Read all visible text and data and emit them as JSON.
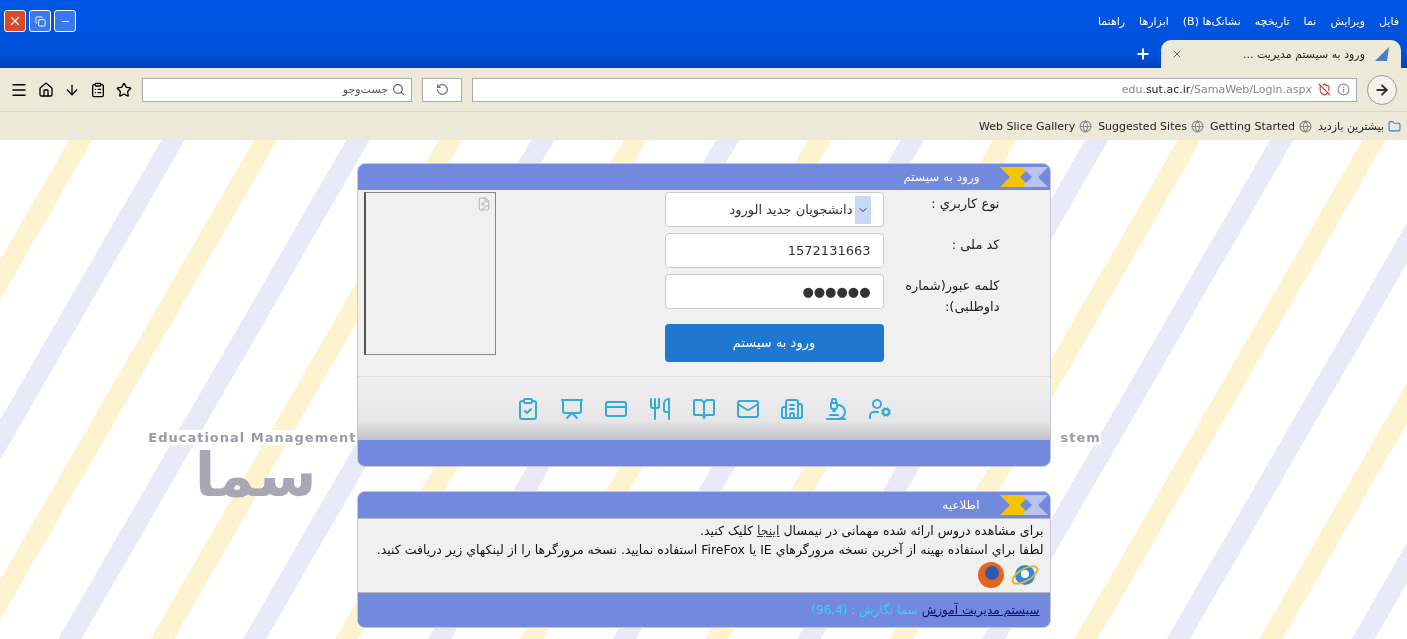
{
  "window": {
    "tab": {
      "title": "ورود به سیستم مدیریت ...",
      "selected": true
    }
  },
  "menu": [
    "فایل",
    "ویرایش",
    "نما",
    "تاریخچه",
    "نشانک‌ها (B)",
    "ابزارها",
    "راهنما"
  ],
  "toolbar": {
    "url": "edu.**sut.ac.ir**/SamaWeb/Login.aspx",
    "search": {
      "placeholder": "جست‌وجو"
    }
  },
  "bookmarks": [
    "بیشترین بازدید",
    "Getting Started",
    "Suggested Sites",
    "Web Slice Gallery"
  ],
  "background": {
    "caption_left": "Educational Management",
    "caption_right": "stem",
    "logo": "سما"
  },
  "login": {
    "title": "ورود به سیستم",
    "fields": [
      {
        "kind": "select",
        "label": "نوع کاربري :",
        "value": "دانشجویان جدید الورود"
      },
      {
        "kind": "text",
        "label": "کد ملی :",
        "value": "1572131663"
      },
      {
        "kind": "password",
        "label": "کلمه عبور(شماره داوطلبی):",
        "value": "●●●●●●"
      }
    ],
    "submit": "ورود به سیستم"
  },
  "notice": {
    "title": "اطلاعیه",
    "line1": {
      "before": "برای مشاهده دروس ارائه شده مهمانی در نیمسال ",
      "link": "اینجا",
      "after": " کلیک کنید."
    },
    "line2": "لطفا براي استفاده بهينه از آخرين نسخه مرورگرهاي IE يا FireFox استفاده نماييد. نسخه مرورگرها را از لينکهاي زير دريافت کنيد.",
    "footer": {
      "link": "سیستم مدیریت آموزش",
      "version": "سما نگارش : (96,4)"
    }
  }
}
